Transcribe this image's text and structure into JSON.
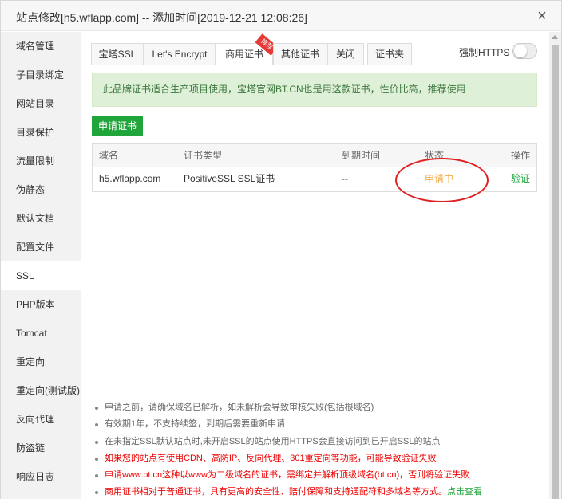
{
  "window": {
    "title": "站点修改[h5.wflapp.com] -- 添加时间[2019-12-21 12:08:26]",
    "close_symbol": "×"
  },
  "sidebar": {
    "items": [
      {
        "label": "域名管理"
      },
      {
        "label": "子目录绑定"
      },
      {
        "label": "网站目录"
      },
      {
        "label": "目录保护"
      },
      {
        "label": "流量限制"
      },
      {
        "label": "伪静态"
      },
      {
        "label": "默认文档"
      },
      {
        "label": "配置文件"
      },
      {
        "label": "SSL",
        "active": true
      },
      {
        "label": "PHP版本"
      },
      {
        "label": "Tomcat"
      },
      {
        "label": "重定向"
      },
      {
        "label": "重定向(测试版)"
      },
      {
        "label": "反向代理"
      },
      {
        "label": "防盗链"
      },
      {
        "label": "响应日志"
      }
    ]
  },
  "tabs": [
    {
      "label": "宝塔SSL"
    },
    {
      "label": "Let's Encrypt"
    },
    {
      "label": "商用证书",
      "active": true,
      "badge": "推荐"
    },
    {
      "label": "其他证书"
    },
    {
      "label": "关闭"
    },
    {
      "label": "证书夹"
    }
  ],
  "force_https": {
    "label": "强制HTTPS",
    "enabled": false
  },
  "notice": "此品牌证书适合生产项目使用，宝塔官网BT.CN也是用这款证书，性价比高，推荐使用",
  "apply_button": "申请证书",
  "table": {
    "columns": [
      "域名",
      "证书类型",
      "到期时间",
      "状态",
      "操作"
    ],
    "rows": [
      {
        "domain": "h5.wflapp.com",
        "type": "PositiveSSL SSL证书",
        "expire": "--",
        "status": "申请中",
        "action": "验证"
      }
    ]
  },
  "tips": [
    {
      "text": "申请之前，请确保域名已解析，如未解析会导致审核失败(包括根域名)",
      "red": false
    },
    {
      "text": "有效期1年，不支持续签，到期后需要重新申请",
      "red": false
    },
    {
      "text": "在未指定SSL默认站点时,未开启SSL的站点使用HTTPS会直接访问到已开启SSL的站点",
      "red": false
    },
    {
      "text": "如果您的站点有使用CDN、高防IP、反向代理、301重定向等功能，可能导致验证失败",
      "red": true
    },
    {
      "text": "申请www.bt.cn这种以www为二级域名的证书，需绑定并解析顶级域名(bt.cn)，否则将验证失败",
      "red": true
    },
    {
      "text": "商用证书相对于普通证书，具有更高的安全性、赔付保障和支持通配符和多域名等方式。",
      "red": true,
      "link": "点击查看"
    }
  ],
  "colors": {
    "accent_green": "#20a53a",
    "pending_orange": "#f0ad4e",
    "warning_red": "#e00000",
    "notice_bg": "#dff0d8"
  }
}
